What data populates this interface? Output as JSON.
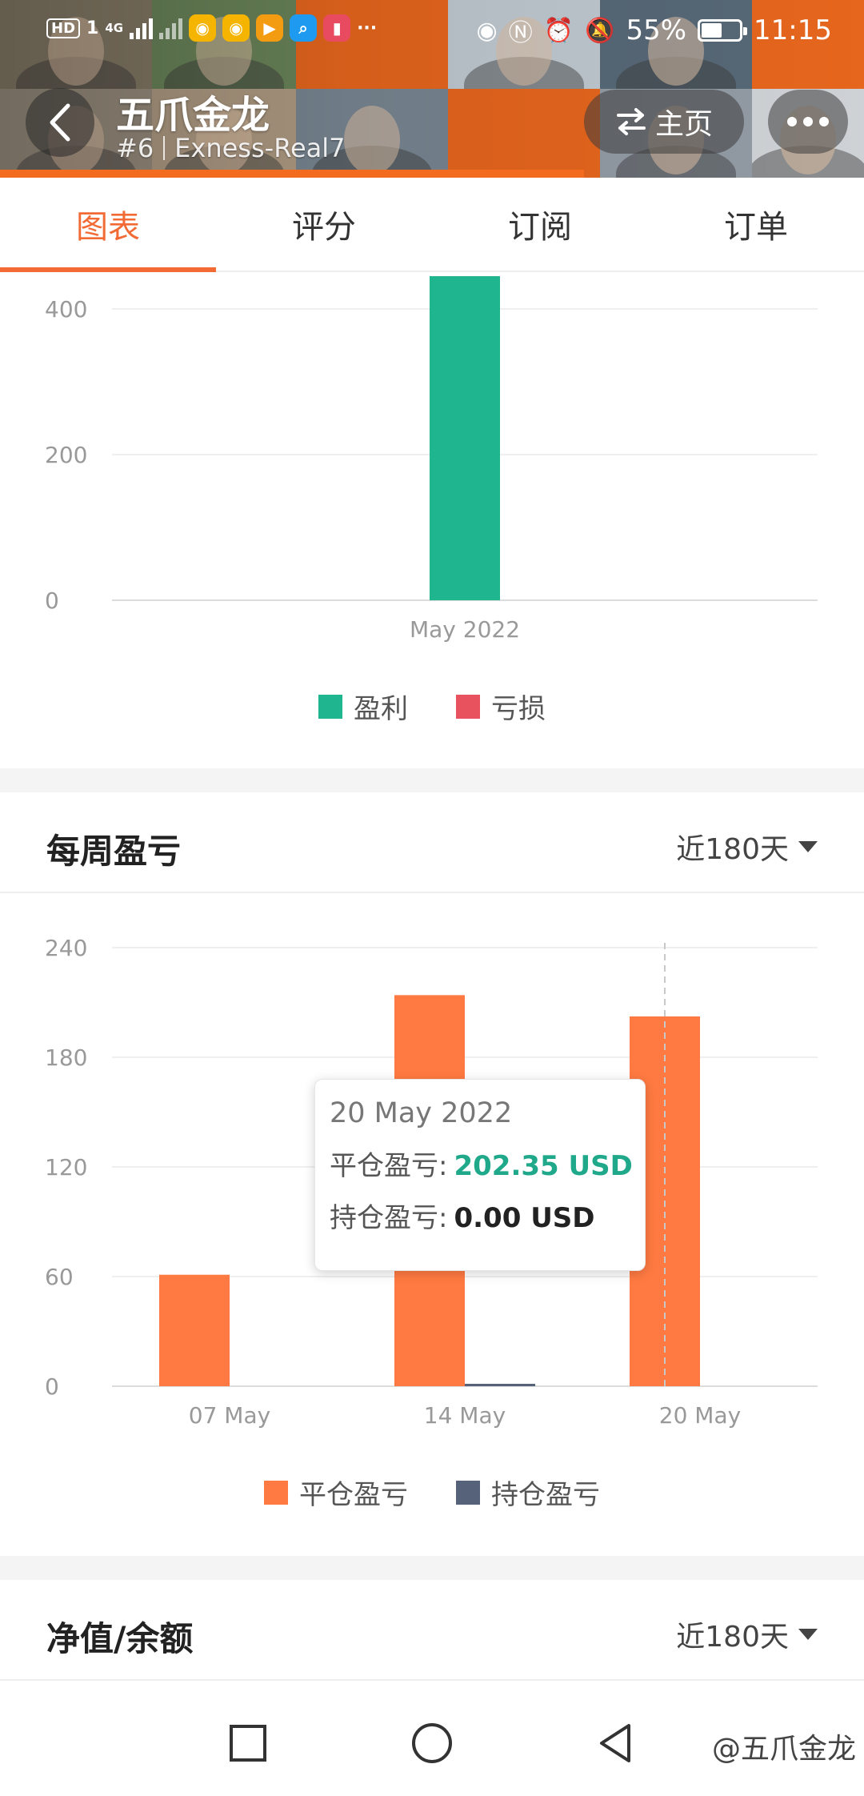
{
  "status_bar": {
    "left_label": "HD",
    "sim": "1",
    "network": "4G",
    "battery": "55%",
    "time": "11:15"
  },
  "header": {
    "title": "五爪金龙",
    "rank": "#6",
    "account": "Exness-Real7",
    "home_label": "主页"
  },
  "tabs": [
    {
      "label": "图表",
      "active": true
    },
    {
      "label": "评分",
      "active": false
    },
    {
      "label": "订阅",
      "active": false
    },
    {
      "label": "订单",
      "active": false
    }
  ],
  "monthly_chart": {
    "legend": [
      {
        "label": "盈利",
        "color": "#1fb58f"
      },
      {
        "label": "亏损",
        "color": "#e8515e"
      }
    ]
  },
  "weekly_section": {
    "title": "每周盈亏",
    "period": "近180天",
    "legend": [
      {
        "label": "平仓盈亏",
        "color": "#ff7a42"
      },
      {
        "label": "持仓盈亏",
        "color": "#56627a"
      }
    ],
    "tooltip": {
      "date": "20 May 2022",
      "closed_label": "平仓盈亏:",
      "closed_value": "202.35 USD",
      "open_label": "持仓盈亏:",
      "open_value": "0.00 USD"
    }
  },
  "equity_section": {
    "title": "净值/余额",
    "period": "近180天"
  },
  "watermark": "@五爪金龙",
  "colors": {
    "accent": "#f26b35",
    "profit": "#1fb58f",
    "loss": "#e8515e",
    "closed_pl": "#ff7a42",
    "open_pl": "#56627a",
    "tooltip_value": "#1fa98a"
  },
  "icons": {
    "back": "back-arrow-icon",
    "home": "swap-arrows-icon",
    "more": "more-dots-icon",
    "dropdown": "caret-down-icon",
    "nav": [
      "square-recents-icon",
      "circle-home-icon",
      "triangle-back-icon"
    ]
  },
  "chart_data": [
    {
      "type": "bar",
      "categories": [
        "May 2022"
      ],
      "series": [
        {
          "name": "盈利",
          "values": [
            445
          ]
        },
        {
          "name": "亏损",
          "values": [
            0
          ]
        }
      ],
      "yticks": [
        0,
        200,
        400
      ],
      "ylim": [
        0,
        445
      ],
      "title": "",
      "xlabel": "",
      "ylabel": "",
      "grid": true,
      "legend": "bottom"
    },
    {
      "type": "bar",
      "categories": [
        "07 May",
        "14 May",
        "20 May"
      ],
      "series": [
        {
          "name": "平仓盈亏",
          "values": [
            61,
            214,
            202.35
          ]
        },
        {
          "name": "持仓盈亏",
          "values": [
            0,
            0.5,
            0
          ]
        }
      ],
      "yticks": [
        0,
        60,
        120,
        180,
        240
      ],
      "ylim": [
        0,
        240
      ],
      "title": "每周盈亏",
      "xlabel": "",
      "ylabel": "",
      "grid": true,
      "legend": "bottom"
    }
  ]
}
